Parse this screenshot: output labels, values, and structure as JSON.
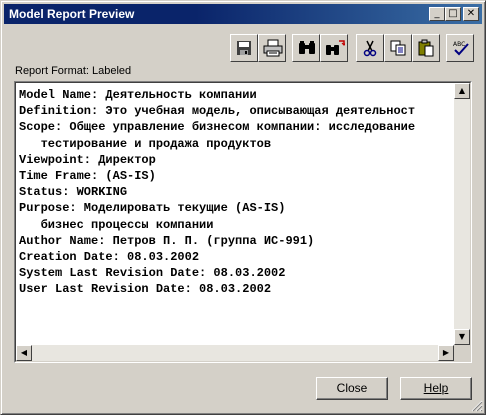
{
  "window": {
    "title": "Model Report Preview",
    "controls": {
      "minimize": "_",
      "maximize": "□",
      "close": "✕"
    }
  },
  "toolbar": {
    "buttons": [
      {
        "name": "save",
        "icon": "floppy-disk-icon"
      },
      {
        "name": "print",
        "icon": "printer-icon"
      },
      {
        "name": "find",
        "icon": "binoculars-icon"
      },
      {
        "name": "replace",
        "icon": "binoculars-replace-icon"
      },
      {
        "name": "cut",
        "icon": "scissors-icon"
      },
      {
        "name": "copy",
        "icon": "copy-icon"
      },
      {
        "name": "paste",
        "icon": "clipboard-icon"
      },
      {
        "name": "spellcheck",
        "icon": "abc-check-icon"
      }
    ]
  },
  "report": {
    "format_label": "Report Format: Labeled",
    "lines": [
      "Model Name: Деятельность компании",
      "Definition: Это учебная модель, описывающая деятельност",
      "Scope: Общее управление бизнесом компании: исследование",
      "   тестирование и продажа продуктов",
      "Viewpoint: Директор",
      "Time Frame: (AS-IS)",
      "Status: WORKING",
      "Purpose: Моделировать текущие (AS-IS)",
      "   бизнес процессы компании",
      "Author Name: Петров П. П. (группа ИС-991)",
      "Creation Date: 08.03.2002",
      "System Last Revision Date: 08.03.2002",
      "User Last Revision Date: 08.03.2002"
    ]
  },
  "buttons": {
    "close": "Close",
    "help": "Help"
  }
}
